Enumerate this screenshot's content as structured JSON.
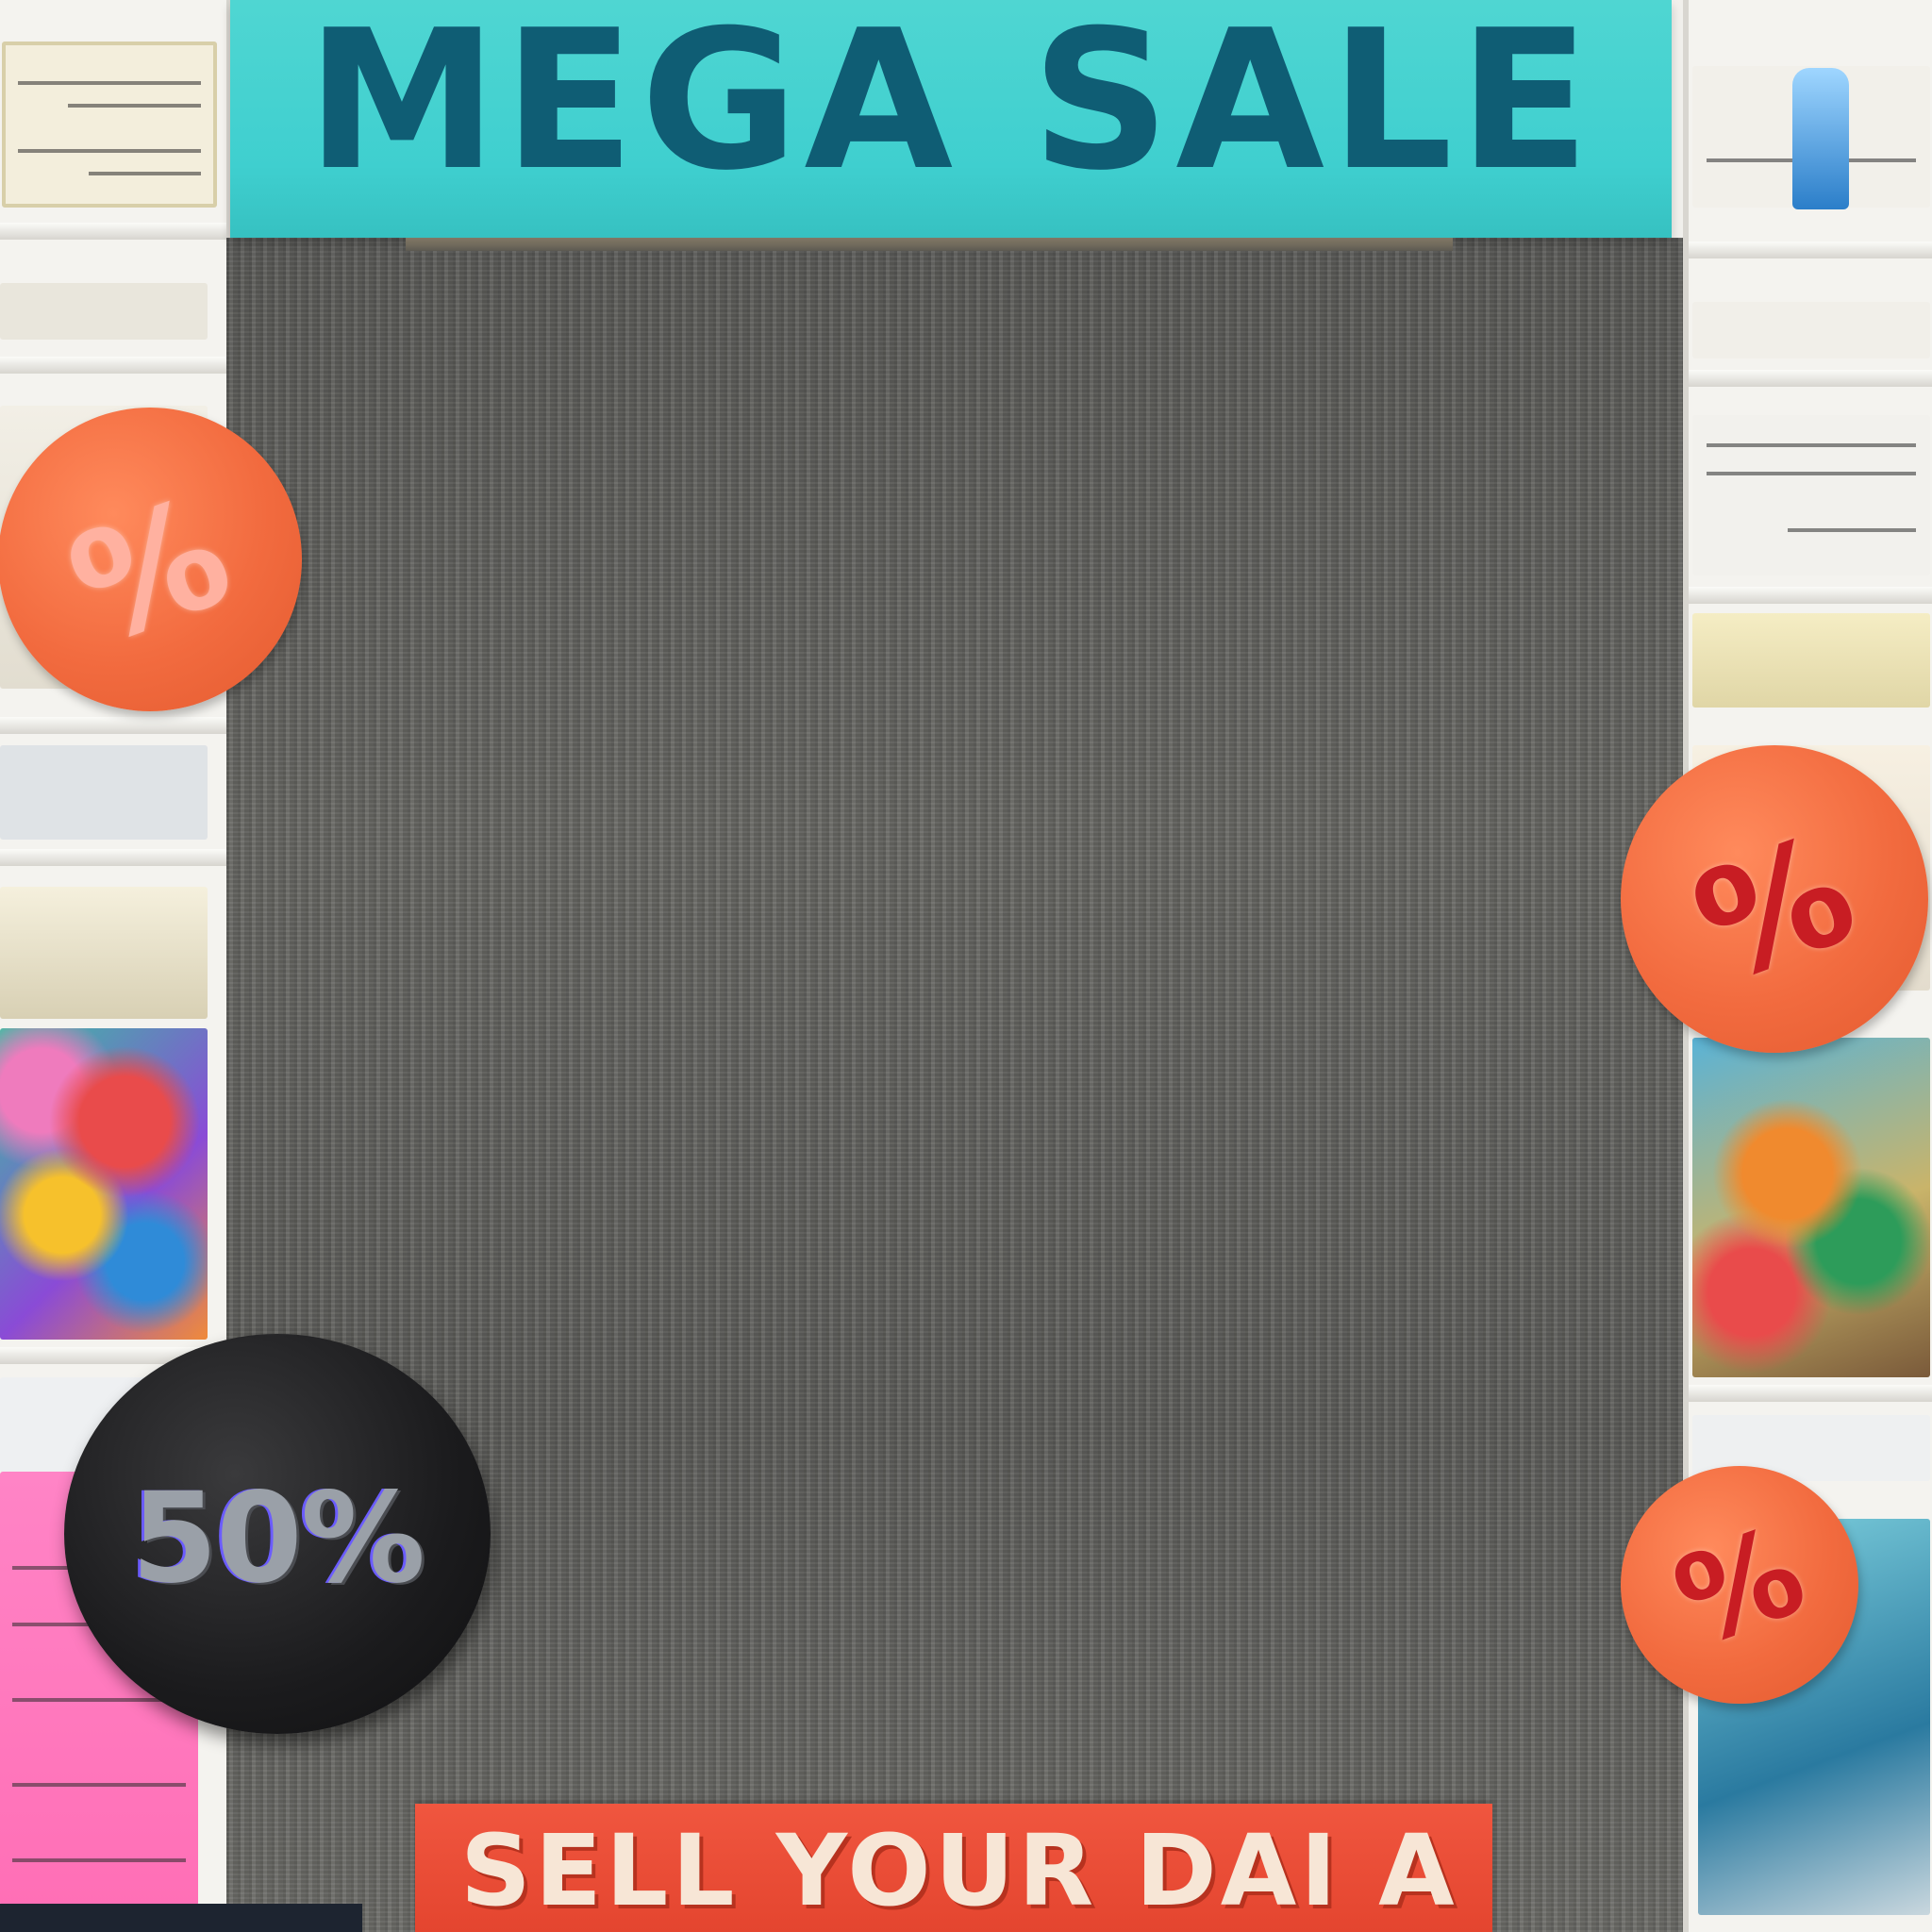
{
  "header": {
    "title": "MEGA SALE",
    "background": "#3fcfcf",
    "text_color": "#0f5d74"
  },
  "badges": [
    {
      "id": "discount-badge",
      "label": "50%",
      "color": "#1b1b1d"
    },
    {
      "id": "percent-sticker",
      "label": "%",
      "color": "#f26b3f"
    }
  ],
  "footer_banner": {
    "text": "SELL YOUR DAI A",
    "background": "#e4452f"
  },
  "board": {
    "texture": "weathered-wood",
    "color": "#62625f"
  }
}
